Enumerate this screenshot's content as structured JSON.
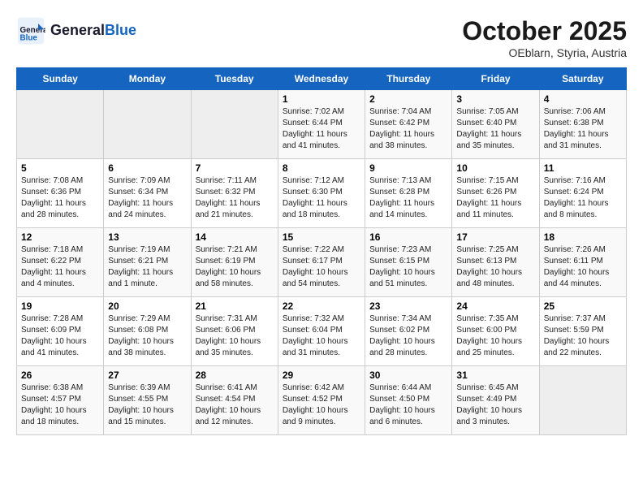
{
  "header": {
    "logo_line1": "General",
    "logo_line2": "Blue",
    "month": "October 2025",
    "location": "OEblarn, Styria, Austria"
  },
  "days_of_week": [
    "Sunday",
    "Monday",
    "Tuesday",
    "Wednesday",
    "Thursday",
    "Friday",
    "Saturday"
  ],
  "weeks": [
    [
      {
        "day": "",
        "info": ""
      },
      {
        "day": "",
        "info": ""
      },
      {
        "day": "",
        "info": ""
      },
      {
        "day": "1",
        "info": "Sunrise: 7:02 AM\nSunset: 6:44 PM\nDaylight: 11 hours\nand 41 minutes."
      },
      {
        "day": "2",
        "info": "Sunrise: 7:04 AM\nSunset: 6:42 PM\nDaylight: 11 hours\nand 38 minutes."
      },
      {
        "day": "3",
        "info": "Sunrise: 7:05 AM\nSunset: 6:40 PM\nDaylight: 11 hours\nand 35 minutes."
      },
      {
        "day": "4",
        "info": "Sunrise: 7:06 AM\nSunset: 6:38 PM\nDaylight: 11 hours\nand 31 minutes."
      }
    ],
    [
      {
        "day": "5",
        "info": "Sunrise: 7:08 AM\nSunset: 6:36 PM\nDaylight: 11 hours\nand 28 minutes."
      },
      {
        "day": "6",
        "info": "Sunrise: 7:09 AM\nSunset: 6:34 PM\nDaylight: 11 hours\nand 24 minutes."
      },
      {
        "day": "7",
        "info": "Sunrise: 7:11 AM\nSunset: 6:32 PM\nDaylight: 11 hours\nand 21 minutes."
      },
      {
        "day": "8",
        "info": "Sunrise: 7:12 AM\nSunset: 6:30 PM\nDaylight: 11 hours\nand 18 minutes."
      },
      {
        "day": "9",
        "info": "Sunrise: 7:13 AM\nSunset: 6:28 PM\nDaylight: 11 hours\nand 14 minutes."
      },
      {
        "day": "10",
        "info": "Sunrise: 7:15 AM\nSunset: 6:26 PM\nDaylight: 11 hours\nand 11 minutes."
      },
      {
        "day": "11",
        "info": "Sunrise: 7:16 AM\nSunset: 6:24 PM\nDaylight: 11 hours\nand 8 minutes."
      }
    ],
    [
      {
        "day": "12",
        "info": "Sunrise: 7:18 AM\nSunset: 6:22 PM\nDaylight: 11 hours\nand 4 minutes."
      },
      {
        "day": "13",
        "info": "Sunrise: 7:19 AM\nSunset: 6:21 PM\nDaylight: 11 hours\nand 1 minute."
      },
      {
        "day": "14",
        "info": "Sunrise: 7:21 AM\nSunset: 6:19 PM\nDaylight: 10 hours\nand 58 minutes."
      },
      {
        "day": "15",
        "info": "Sunrise: 7:22 AM\nSunset: 6:17 PM\nDaylight: 10 hours\nand 54 minutes."
      },
      {
        "day": "16",
        "info": "Sunrise: 7:23 AM\nSunset: 6:15 PM\nDaylight: 10 hours\nand 51 minutes."
      },
      {
        "day": "17",
        "info": "Sunrise: 7:25 AM\nSunset: 6:13 PM\nDaylight: 10 hours\nand 48 minutes."
      },
      {
        "day": "18",
        "info": "Sunrise: 7:26 AM\nSunset: 6:11 PM\nDaylight: 10 hours\nand 44 minutes."
      }
    ],
    [
      {
        "day": "19",
        "info": "Sunrise: 7:28 AM\nSunset: 6:09 PM\nDaylight: 10 hours\nand 41 minutes."
      },
      {
        "day": "20",
        "info": "Sunrise: 7:29 AM\nSunset: 6:08 PM\nDaylight: 10 hours\nand 38 minutes."
      },
      {
        "day": "21",
        "info": "Sunrise: 7:31 AM\nSunset: 6:06 PM\nDaylight: 10 hours\nand 35 minutes."
      },
      {
        "day": "22",
        "info": "Sunrise: 7:32 AM\nSunset: 6:04 PM\nDaylight: 10 hours\nand 31 minutes."
      },
      {
        "day": "23",
        "info": "Sunrise: 7:34 AM\nSunset: 6:02 PM\nDaylight: 10 hours\nand 28 minutes."
      },
      {
        "day": "24",
        "info": "Sunrise: 7:35 AM\nSunset: 6:00 PM\nDaylight: 10 hours\nand 25 minutes."
      },
      {
        "day": "25",
        "info": "Sunrise: 7:37 AM\nSunset: 5:59 PM\nDaylight: 10 hours\nand 22 minutes."
      }
    ],
    [
      {
        "day": "26",
        "info": "Sunrise: 6:38 AM\nSunset: 4:57 PM\nDaylight: 10 hours\nand 18 minutes."
      },
      {
        "day": "27",
        "info": "Sunrise: 6:39 AM\nSunset: 4:55 PM\nDaylight: 10 hours\nand 15 minutes."
      },
      {
        "day": "28",
        "info": "Sunrise: 6:41 AM\nSunset: 4:54 PM\nDaylight: 10 hours\nand 12 minutes."
      },
      {
        "day": "29",
        "info": "Sunrise: 6:42 AM\nSunset: 4:52 PM\nDaylight: 10 hours\nand 9 minutes."
      },
      {
        "day": "30",
        "info": "Sunrise: 6:44 AM\nSunset: 4:50 PM\nDaylight: 10 hours\nand 6 minutes."
      },
      {
        "day": "31",
        "info": "Sunrise: 6:45 AM\nSunset: 4:49 PM\nDaylight: 10 hours\nand 3 minutes."
      },
      {
        "day": "",
        "info": ""
      }
    ]
  ]
}
